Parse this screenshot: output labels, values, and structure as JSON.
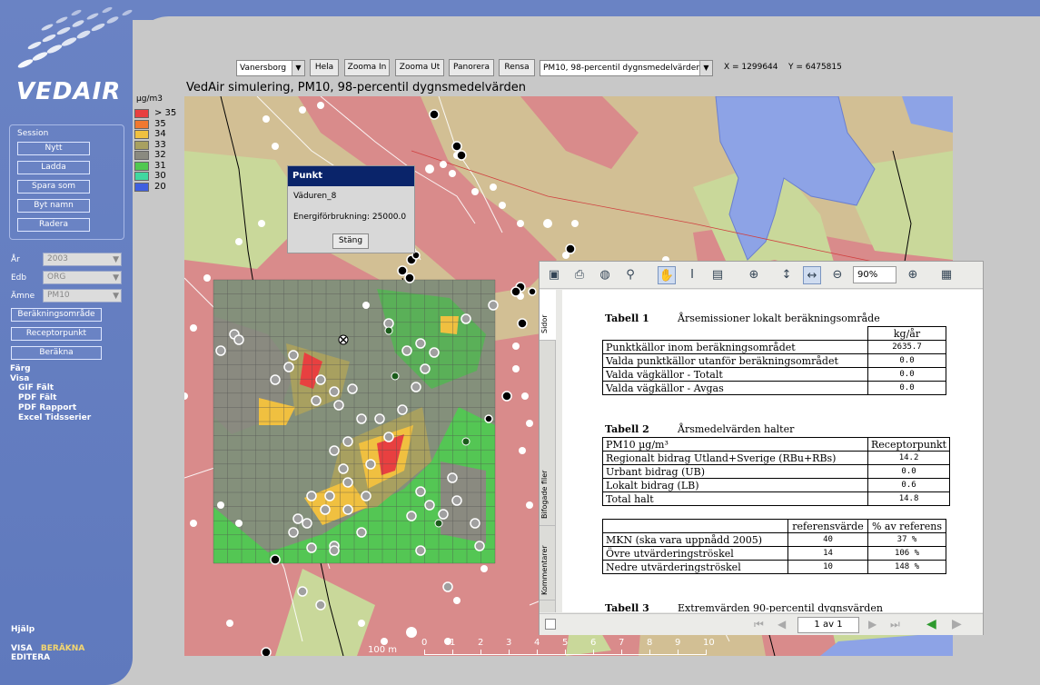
{
  "app": {
    "logo": "VEDAIR"
  },
  "session": {
    "title": "Session",
    "buttons": [
      "Nytt",
      "Ladda",
      "Spara som",
      "Byt namn",
      "Radera"
    ]
  },
  "filters": {
    "year_label": "År",
    "year_value": "2003",
    "edb_label": "Edb",
    "edb_value": "ORG",
    "subject_label": "Ämne",
    "subject_value": "PM10"
  },
  "workflow": {
    "area_button": "Beräkningsområde",
    "receptor_button": "Receptorpunkt",
    "calc_button": "Beräkna"
  },
  "menu": {
    "color": "Färg",
    "show": "Visa",
    "gif": "GIF Fält",
    "pdf_field": "PDF Fält",
    "pdf_report": "PDF Rapport",
    "excel": "Excel Tidsserier",
    "help": "Hjälp"
  },
  "bottom_nav": {
    "visa": "VISA",
    "berakna": "BERÄKNA",
    "editera": "EDITERA"
  },
  "toolbar": {
    "region": "Vanersborg",
    "hela": "Hela",
    "zoom_in": "Zooma In",
    "zoom_out": "Zooma Ut",
    "pan": "Panorera",
    "clear": "Rensa",
    "layer": "PM10, 98-percentil dygnsmedelvärden",
    "x_coord": "X = 1299644",
    "y_coord": "Y = 6475815"
  },
  "map": {
    "title": "VedAir simulering, PM10, 98-percentil dygnsmedelvärden",
    "scale_unit": "100 m",
    "scale_ticks": [
      "0",
      "1",
      "2",
      "3",
      "4",
      "5",
      "6",
      "7",
      "8",
      "9",
      "10"
    ]
  },
  "legend": {
    "unit": "µg/m3",
    "items": [
      {
        "label": "> 35",
        "color": "#e84040"
      },
      {
        "label": "35",
        "color": "#f07830"
      },
      {
        "label": "34",
        "color": "#f0c040"
      },
      {
        "label": "33",
        "color": "#a8a060"
      },
      {
        "label": "32",
        "color": "#8a8a80"
      },
      {
        "label": "31",
        "color": "#50c850"
      },
      {
        "label": "30",
        "color": "#40d8a0"
      },
      {
        "label": "20",
        "color": "#4060e0"
      }
    ]
  },
  "popup": {
    "title": "Punkt",
    "name": "Väduren_8",
    "energy": "Energiförbrukning: 25000.0",
    "close": "Stäng"
  },
  "pdf": {
    "zoom": "90%",
    "page": "1 av 1",
    "tabs": [
      "Sidor",
      "Bifogade filer",
      "Kommentarer"
    ],
    "table1": {
      "title": "Tabell 1",
      "subtitle": "Årsemissioner lokalt beräkningsområde",
      "unit": "kg/år",
      "rows": [
        {
          "label": "Punktkällor inom beräkningsområdet",
          "value": "2635.7"
        },
        {
          "label": "Valda punktkällor utanför beräkningsområdet",
          "value": "0.0"
        },
        {
          "label": "Valda vägkällor - Totalt",
          "value": "0.0"
        },
        {
          "label": "Valda vägkällor - Avgas",
          "value": "0.0"
        }
      ]
    },
    "table2": {
      "title": "Tabell 2",
      "subtitle": "Årsmedelvärden halter",
      "col1": "PM10 µg/m³",
      "col2": "Receptorpunkt",
      "rows": [
        {
          "label": "Regionalt bidrag Utland+Sverige (RBu+RBs)",
          "value": "14.2"
        },
        {
          "label": "Urbant bidrag (UB)",
          "value": "0.0"
        },
        {
          "label": "Lokalt bidrag (LB)",
          "value": "0.6"
        },
        {
          "label": "Total halt",
          "value": "14.8"
        }
      ]
    },
    "table_ref": {
      "col1": "referensvärde",
      "col2": "% av referens",
      "rows": [
        {
          "label": "MKN (ska vara uppnådd 2005)",
          "ref": "40",
          "pct": "37 %"
        },
        {
          "label": "Övre utvärderingströskel",
          "ref": "14",
          "pct": "106 %"
        },
        {
          "label": "Nedre utvärderingströskel",
          "ref": "10",
          "pct": "148 %"
        }
      ]
    },
    "table3": {
      "title": "Tabell 3",
      "subtitle": "Extremvärden 90-percentil dygnsvärden"
    }
  }
}
